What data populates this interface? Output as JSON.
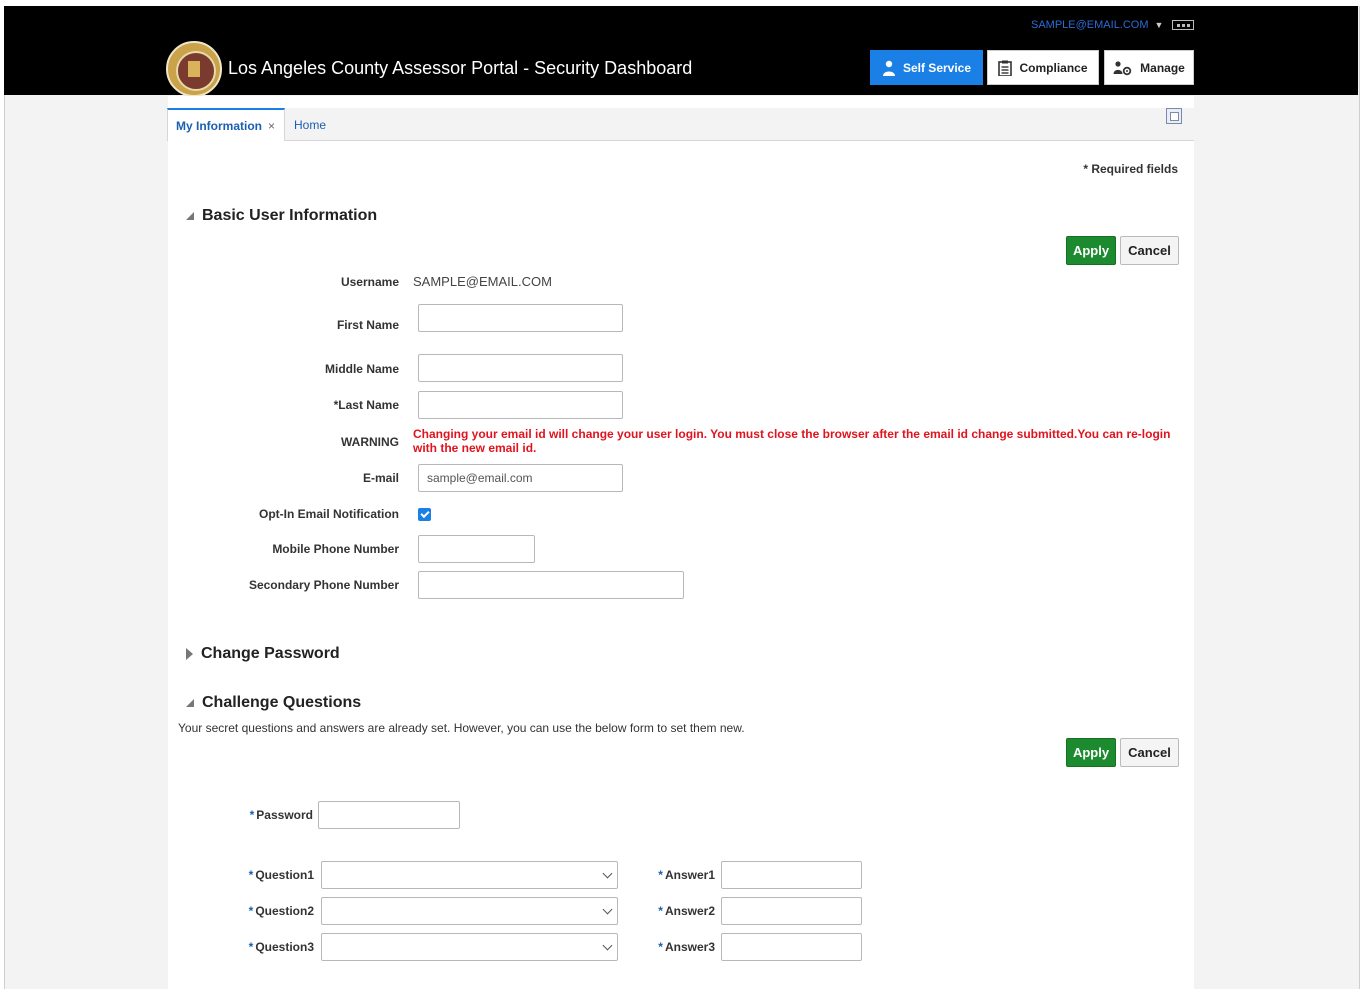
{
  "header": {
    "title": "Los Angeles County Assessor Portal - Security Dashboard",
    "user_email": "SAMPLE@EMAIL.COM",
    "nav": [
      {
        "label": "Self Service",
        "icon": "person-icon",
        "active": true
      },
      {
        "label": "Compliance",
        "icon": "clipboard-icon",
        "active": false
      },
      {
        "label": "Manage",
        "icon": "people-gear-icon",
        "active": false
      }
    ]
  },
  "tabs": {
    "my_information": "My Information",
    "close_glyph": "×",
    "home": "Home"
  },
  "required_note": "* Required fields",
  "basic": {
    "title": "Basic User Information",
    "apply": "Apply",
    "cancel": "Cancel",
    "username_label": "Username",
    "username_value": "SAMPLE@EMAIL.COM",
    "first_name_label": "First Name",
    "first_name_value": "",
    "middle_name_label": "Middle Name",
    "middle_name_value": "",
    "last_name_label": "*Last Name",
    "last_name_value": "",
    "warning_label": "WARNING",
    "warning_text": "Changing your email id will change your user login. You must close the browser after the email id change submitted.You can re-login with the new email id.",
    "email_label": "E-mail",
    "email_value": "sample@email.com",
    "optin_label": "Opt-In Email Notification",
    "optin_checked": true,
    "mobile_label": "Mobile Phone Number",
    "mobile_value": "",
    "secondary_label": "Secondary Phone Number",
    "secondary_value": ""
  },
  "change_password": {
    "title": "Change Password"
  },
  "challenge": {
    "title": "Challenge Questions",
    "description": "Your secret questions and answers are already set. However, you can use the below form to set them new.",
    "apply": "Apply",
    "cancel": "Cancel",
    "password_label": "Password",
    "question1_label": "Question1",
    "question2_label": "Question2",
    "question3_label": "Question3",
    "answer1_label": "Answer1",
    "answer2_label": "Answer2",
    "answer3_label": "Answer3"
  },
  "colors": {
    "brand_blue": "#1a80e6",
    "apply_green": "#1c8a2e",
    "warning_red": "#e0141e",
    "header_black": "#000000"
  }
}
